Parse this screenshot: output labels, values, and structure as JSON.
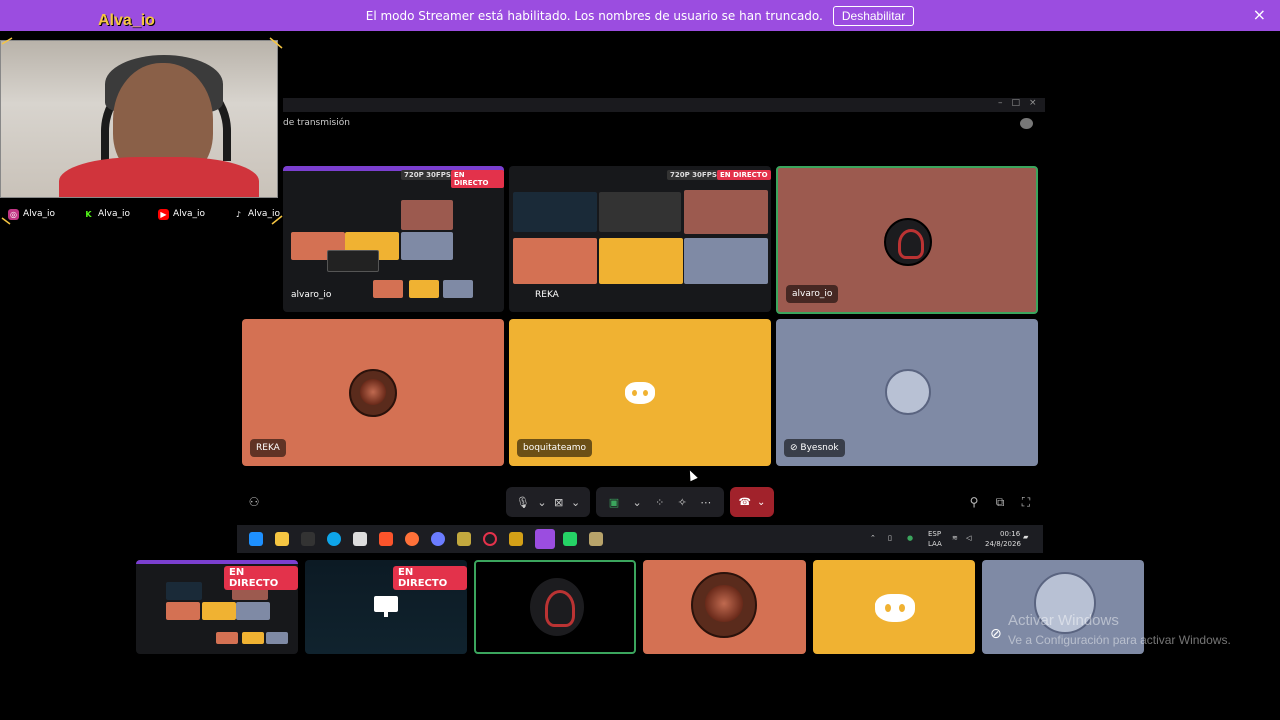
{
  "banner": {
    "message": "El modo Streamer está habilitado. Los nombres de usuario se han truncado.",
    "button_label": "Deshabilitar",
    "close_icon": "×"
  },
  "overlay": {
    "streamer_name": "Alva_io",
    "socials": [
      {
        "icon": "instagram-icon",
        "handle": "Alva_io",
        "color": "#c13584"
      },
      {
        "icon": "kick-icon",
        "handle": "Alva_io",
        "color": "#53fc18"
      },
      {
        "icon": "youtube-icon",
        "handle": "Alva_io",
        "color": "#ff0000"
      },
      {
        "icon": "tiktok-icon",
        "handle": "Alva_io",
        "color": "#ffffff"
      }
    ]
  },
  "window": {
    "subtitle": "de transmisión",
    "controls": [
      "–",
      "□",
      "×"
    ]
  },
  "grid": {
    "tiles": [
      {
        "name": "alvaro_io",
        "quality": "720P 30FPS",
        "live": "EN DIRECTO",
        "kind": "screen"
      },
      {
        "name": "REKA",
        "quality": "720P 30FPS",
        "live": "EN DIRECTO",
        "kind": "screen"
      },
      {
        "name": "alvaro_io",
        "kind": "avatar",
        "bg": "#9c5a4f"
      },
      {
        "name": "REKA",
        "kind": "avatar",
        "bg": "#d47153"
      },
      {
        "name": "boquitateamo",
        "kind": "avatar",
        "bg": "#f0b232"
      },
      {
        "name": "Byesnok",
        "kind": "avatar",
        "bg": "#7f8aa5"
      }
    ]
  },
  "filmstrip": {
    "items": [
      {
        "live": "EN DIRECTO",
        "kind": "screen"
      },
      {
        "live": "EN DIRECTO",
        "kind": "screen-dark"
      },
      {
        "kind": "avatar-dark"
      },
      {
        "kind": "avatar-red",
        "bg": "#d47153"
      },
      {
        "kind": "discord",
        "bg": "#f0b232"
      },
      {
        "kind": "avatar-blue",
        "bg": "#7f8aa5"
      }
    ]
  },
  "taskbar": {
    "lang": "ESP",
    "lang_sub": "LAA",
    "time": "00:16",
    "date": "24/8/2026"
  },
  "watermark": {
    "title": "Activar Windows",
    "subtitle": "Ve a Configuración para activar Windows."
  },
  "colors": {
    "accent": "#9b4de0",
    "live": "#e3324b",
    "hangup": "#a1222b",
    "speaking": "#3ba55d"
  }
}
